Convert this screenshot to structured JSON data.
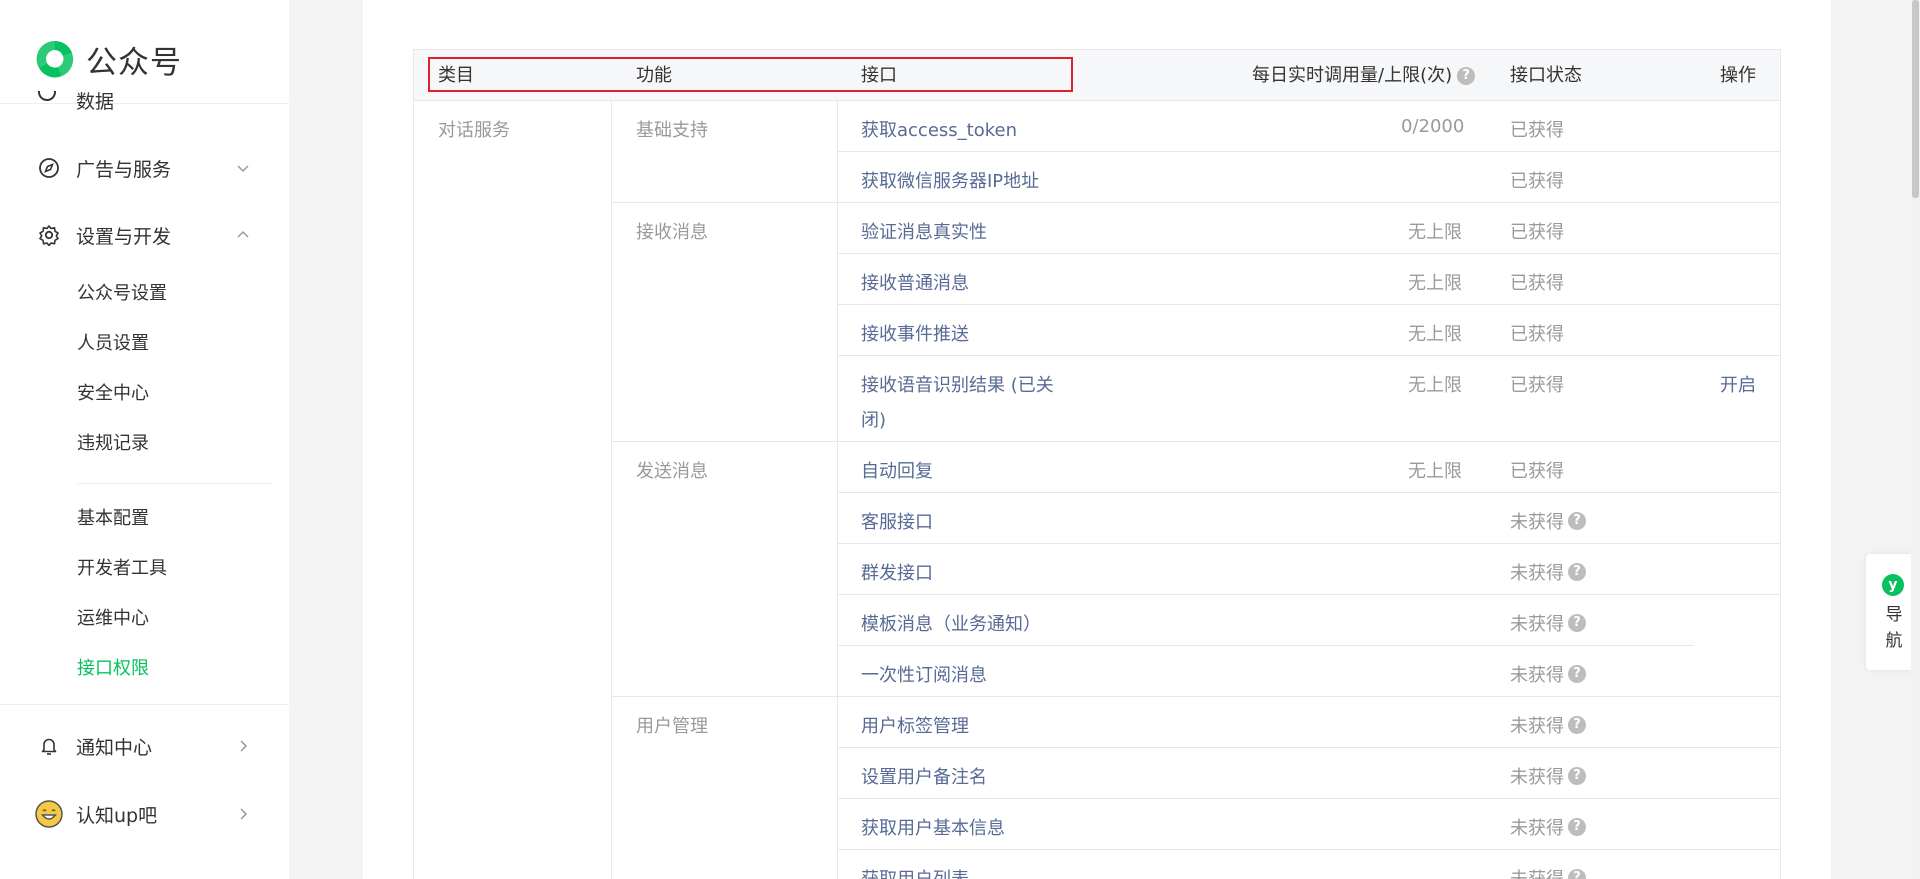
{
  "app": {
    "name": "公众号"
  },
  "sidebar": {
    "cut_item": "数据",
    "groups": [
      {
        "label": "广告与服务",
        "icon": "compass-icon",
        "arrow": "chevron-down-icon"
      },
      {
        "label": "设置与开发",
        "icon": "gear-icon",
        "arrow": "chevron-up-icon"
      }
    ],
    "settings_items": [
      "公众号设置",
      "人员设置",
      "安全中心",
      "违规记录"
    ],
    "dev_items": [
      "基本配置",
      "开发者工具",
      "运维中心",
      "接口权限"
    ],
    "active_item": "接口权限",
    "bottom_groups": [
      {
        "label": "通知中心",
        "icon": "bell-icon"
      },
      {
        "label": "认知up吧",
        "icon": "smiley-icon"
      }
    ]
  },
  "table": {
    "headers": {
      "category": "类目",
      "feature": "功能",
      "api": "接口",
      "quota": "每日实时调用量/上限(次)",
      "status": "接口状态",
      "action": "操作"
    },
    "category": "对话服务",
    "groups": [
      {
        "feature": "基础支持",
        "rows": [
          {
            "api": "获取access_token",
            "quota": "0/2000",
            "status": "已获得"
          },
          {
            "api": "获取微信服务器IP地址",
            "quota": "",
            "status": "已获得"
          }
        ]
      },
      {
        "feature": "接收消息",
        "rows": [
          {
            "api": "验证消息真实性",
            "quota": "无上限",
            "status": "已获得"
          },
          {
            "api": "接收普通消息",
            "quota": "无上限",
            "status": "已获得"
          },
          {
            "api": "接收事件推送",
            "quota": "无上限",
            "status": "已获得"
          },
          {
            "api_line1": "接收语音识别结果 (已关",
            "api_line2": "闭)",
            "quota": "无上限",
            "status": "已获得",
            "action": "开启"
          }
        ]
      },
      {
        "feature": "发送消息",
        "rows": [
          {
            "api": "自动回复",
            "quota": "无上限",
            "status": "已获得"
          },
          {
            "api": "客服接口",
            "quota": "",
            "status": "未获得"
          },
          {
            "api": "群发接口",
            "quota": "",
            "status": "未获得"
          },
          {
            "api": "模板消息（业务通知）",
            "quota": "",
            "status": "未获得"
          },
          {
            "api": "一次性订阅消息",
            "quota": "",
            "status": "未获得"
          }
        ]
      },
      {
        "feature": "用户管理",
        "rows": [
          {
            "api": "用户标签管理",
            "quota": "",
            "status": "未获得"
          },
          {
            "api": "设置用户备注名",
            "quota": "",
            "status": "未获得"
          },
          {
            "api": "获取用户基本信息",
            "quota": "",
            "status": "未获得"
          },
          {
            "api": "获取用户列表",
            "quota": "",
            "status": "未获得"
          }
        ]
      }
    ],
    "help_glyph": "?"
  },
  "float_nav": {
    "badge": "y",
    "line1": "导",
    "line2": "航"
  },
  "colors": {
    "accent": "#07c160",
    "link": "#576b95",
    "highlight": "#e0202a"
  }
}
